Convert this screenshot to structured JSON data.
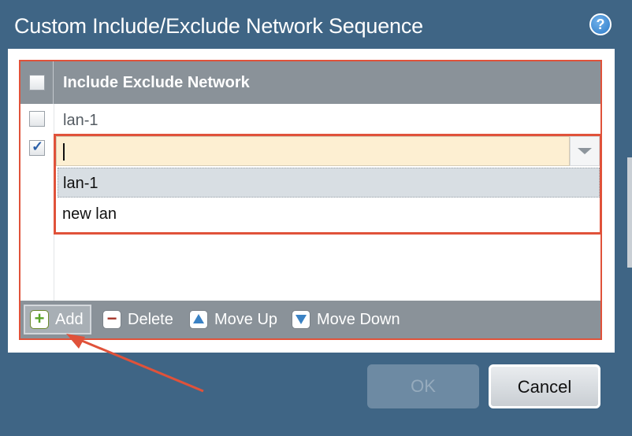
{
  "dialog": {
    "title": "Custom Include/Exclude Network Sequence",
    "help_glyph": "?"
  },
  "grid": {
    "column_header": "Include Exclude Network",
    "rows": [
      {
        "value": "lan-1",
        "checked": false
      },
      {
        "value": "",
        "checked": true,
        "editing": true
      }
    ]
  },
  "dropdown": {
    "options": [
      "lan-1",
      "new lan"
    ],
    "hovered_option": "lan-1"
  },
  "toolbar": {
    "add_label": "Add",
    "delete_label": "Delete",
    "move_up_label": "Move Up",
    "move_down_label": "Move Down"
  },
  "footer": {
    "ok_label": "OK",
    "ok_enabled": false,
    "cancel_label": "Cancel"
  },
  "colors": {
    "dialog_bg": "#3f6585",
    "header_bg": "#8a9299",
    "highlight_red": "#e0523a",
    "edit_field_bg": "#fdefd2"
  },
  "icons": {
    "help": "help-icon",
    "add": "plus-icon",
    "delete": "minus-icon",
    "move_up": "arrow-up-icon",
    "move_down": "arrow-down-icon",
    "dropdown": "chevron-down-icon"
  }
}
